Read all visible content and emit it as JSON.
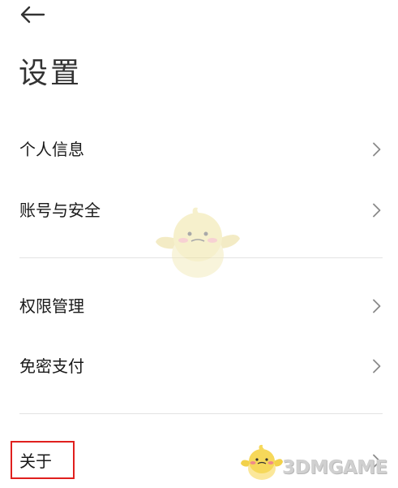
{
  "header": {
    "back_icon": "arrow-left-icon",
    "title": "设置"
  },
  "menu": {
    "groups": [
      {
        "items": [
          {
            "label": "个人信息",
            "icon": "chevron-right-icon"
          },
          {
            "label": "账号与安全",
            "icon": "chevron-right-icon"
          }
        ]
      },
      {
        "items": [
          {
            "label": "权限管理",
            "icon": "chevron-right-icon"
          },
          {
            "label": "免密支付",
            "icon": "chevron-right-icon"
          }
        ]
      },
      {
        "items": [
          {
            "label": "关于",
            "icon": "chevron-right-icon"
          }
        ]
      }
    ]
  },
  "annotation": {
    "highlight_color": "#e0201e"
  },
  "watermark": {
    "text": "3DMGAME",
    "mascot_icon": "chick-mascot-icon"
  },
  "colors": {
    "background": "#ffffff",
    "text": "#1a1a1a",
    "title": "#333333",
    "divider": "#e3e3e3",
    "chevron": "#8a8a8a"
  }
}
